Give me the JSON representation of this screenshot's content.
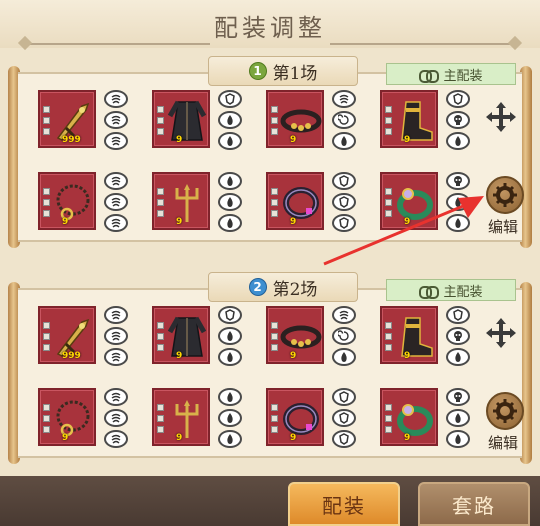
{
  "title": "配装调整",
  "loadouts": [
    {
      "badge": "1",
      "label": "第1场",
      "main_button": "主配装",
      "edit_label": "编辑",
      "rows": [
        [
          {
            "item": "dagger",
            "level": "999",
            "pips": 3,
            "gems": [
              "wind-gem-icon",
              "wind-gem-icon",
              "wind-gem-icon"
            ]
          },
          {
            "item": "robe",
            "level": "9",
            "pips": 3,
            "gems": [
              "shield-gem-icon",
              "fire-gem-icon",
              "fire-gem-icon"
            ]
          },
          {
            "item": "belt",
            "level": "9",
            "pips": 3,
            "gems": [
              "wind-gem-icon",
              "swirl-gem-icon",
              "fire-gem-icon"
            ]
          },
          {
            "item": "boots",
            "level": "9",
            "pips": 3,
            "gems": [
              "shield-gem-icon",
              "skull-gem-icon",
              "fire-gem-icon"
            ]
          }
        ],
        [
          {
            "item": "necklace",
            "level": "9",
            "pips": 3,
            "gems": [
              "wind-gem-icon",
              "wind-gem-icon",
              "wind-gem-icon"
            ]
          },
          {
            "item": "trident",
            "level": "9",
            "pips": 3,
            "gems": [
              "fire-gem-icon",
              "fire-gem-icon",
              "fire-gem-icon"
            ]
          },
          {
            "item": "bracelet",
            "level": "9",
            "pips": 3,
            "gems": [
              "shield-gem-icon",
              "shield-gem-icon",
              "shield-gem-icon"
            ]
          },
          {
            "item": "jade-ring",
            "level": "9",
            "pips": 3,
            "gems": [
              "skull-gem-icon",
              "fire-gem-icon",
              "fire-gem-icon"
            ]
          }
        ]
      ]
    },
    {
      "badge": "2",
      "label": "第2场",
      "main_button": "主配装",
      "edit_label": "编辑",
      "rows": [
        [
          {
            "item": "dagger",
            "level": "999",
            "pips": 3,
            "gems": [
              "wind-gem-icon",
              "wind-gem-icon",
              "wind-gem-icon"
            ]
          },
          {
            "item": "robe",
            "level": "9",
            "pips": 3,
            "gems": [
              "shield-gem-icon",
              "fire-gem-icon",
              "fire-gem-icon"
            ]
          },
          {
            "item": "belt",
            "level": "9",
            "pips": 3,
            "gems": [
              "wind-gem-icon",
              "swirl-gem-icon",
              "fire-gem-icon"
            ]
          },
          {
            "item": "boots",
            "level": "9",
            "pips": 3,
            "gems": [
              "shield-gem-icon",
              "skull-gem-icon",
              "fire-gem-icon"
            ]
          }
        ],
        [
          {
            "item": "necklace",
            "level": "9",
            "pips": 3,
            "gems": [
              "wind-gem-icon",
              "wind-gem-icon",
              "wind-gem-icon"
            ]
          },
          {
            "item": "trident",
            "level": "9",
            "pips": 3,
            "gems": [
              "fire-gem-icon",
              "fire-gem-icon",
              "fire-gem-icon"
            ]
          },
          {
            "item": "bracelet",
            "level": "9",
            "pips": 3,
            "gems": [
              "shield-gem-icon",
              "shield-gem-icon",
              "shield-gem-icon"
            ]
          },
          {
            "item": "jade-ring",
            "level": "9",
            "pips": 3,
            "gems": [
              "skull-gem-icon",
              "fire-gem-icon",
              "fire-gem-icon"
            ]
          }
        ]
      ]
    }
  ],
  "footer": {
    "active_tab": "配装",
    "inactive_tab": "套路"
  },
  "colors": {
    "slot_bg": "#a8333c",
    "accent_green": "#d9eec7",
    "footer_bg": "#4f3f36",
    "arrow": "#e8322e"
  }
}
